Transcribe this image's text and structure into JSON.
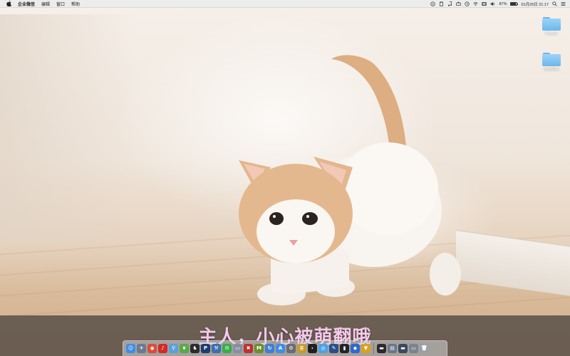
{
  "menubar": {
    "app_name": "企业微信",
    "menus": [
      "编辑",
      "窗口",
      "帮助"
    ],
    "battery_percent": "87%",
    "battery_level": 0.87,
    "datetime": "01月29日 21:17"
  },
  "desktop": {
    "icons": [
      {
        "label": "Picture",
        "icon": "folder-icon"
      },
      {
        "label": "mainfiles",
        "icon": "folder-icon"
      }
    ]
  },
  "caption": {
    "text": "主人，小心被萌翻哦",
    "color": "#f4c9ea"
  },
  "dock": {
    "apps": [
      {
        "name": "finder",
        "icon": "finder-icon",
        "glyph": "☺",
        "color": "#3d8ee6"
      },
      {
        "name": "launchpad",
        "icon": "launchpad-icon",
        "glyph": "✈",
        "color": "#6b7a90"
      },
      {
        "name": "chrome",
        "icon": "chrome-icon",
        "glyph": "◉",
        "color": "#dd4b39"
      },
      {
        "name": "netease-music",
        "icon": "music-icon",
        "glyph": "♪",
        "color": "#d42a2a"
      },
      {
        "name": "search",
        "icon": "search-icon",
        "glyph": "⚲",
        "color": "#5aa0d8"
      },
      {
        "name": "leaf",
        "icon": "leaf-icon",
        "glyph": "❦",
        "color": "#58a845"
      },
      {
        "name": "qq",
        "icon": "qq-icon",
        "glyph": "♞",
        "color": "#2b2b2b"
      },
      {
        "name": "photoshop",
        "icon": "photoshop-icon",
        "glyph": "P",
        "color": "#1d3c6e"
      },
      {
        "name": "xcode",
        "icon": "xcode-icon",
        "glyph": "⚒",
        "color": "#3a6fb0"
      },
      {
        "name": "wechat",
        "icon": "wechat-icon",
        "glyph": "✉",
        "color": "#34b047"
      },
      {
        "name": "preview",
        "icon": "preview-icon",
        "glyph": "▭",
        "color": "#8a8fa0"
      },
      {
        "name": "app-red",
        "icon": "app-icon",
        "glyph": "✖",
        "color": "#c03030"
      },
      {
        "name": "markdown",
        "icon": "markdown-icon",
        "glyph": "M",
        "color": "#6b8f2a"
      },
      {
        "name": "sync",
        "icon": "sync-icon",
        "glyph": "↻",
        "color": "#3f7fd0"
      },
      {
        "name": "appstore",
        "icon": "appstore-icon",
        "glyph": "A",
        "color": "#3c8dea"
      },
      {
        "name": "settings",
        "icon": "gear-icon",
        "glyph": "⚙",
        "color": "#6a6a70"
      },
      {
        "name": "notes",
        "icon": "notes-icon",
        "glyph": "≣",
        "color": "#c89a2a"
      },
      {
        "name": "terminal",
        "icon": "terminal-icon",
        "glyph": "›",
        "color": "#1f1f1f"
      },
      {
        "name": "safari",
        "icon": "safari-icon",
        "glyph": "◎",
        "color": "#4aa3e8"
      },
      {
        "name": "editor",
        "icon": "editor-icon",
        "glyph": "✎",
        "color": "#2a4f8a"
      },
      {
        "name": "console",
        "icon": "console-icon",
        "glyph": "▮",
        "color": "#222426"
      },
      {
        "name": "blue-app",
        "icon": "app-icon",
        "glyph": "◆",
        "color": "#2a6ad0"
      },
      {
        "name": "vpn",
        "icon": "vpn-icon",
        "glyph": "▼",
        "color": "#d9a11f"
      }
    ],
    "docs": [
      {
        "name": "doc-1",
        "icon": "window-icon",
        "glyph": "▬",
        "color": "#2a2a2e"
      },
      {
        "name": "doc-2",
        "icon": "window-icon",
        "glyph": "▤",
        "color": "#6a7788"
      },
      {
        "name": "doc-3",
        "icon": "window-icon",
        "glyph": "▬",
        "color": "#3a4a5e"
      },
      {
        "name": "doc-4",
        "icon": "window-icon",
        "glyph": "▭",
        "color": "#7a8490"
      },
      {
        "name": "trash",
        "icon": "trash-icon",
        "glyph": "🗑",
        "color": "#9aa0a8"
      }
    ]
  }
}
